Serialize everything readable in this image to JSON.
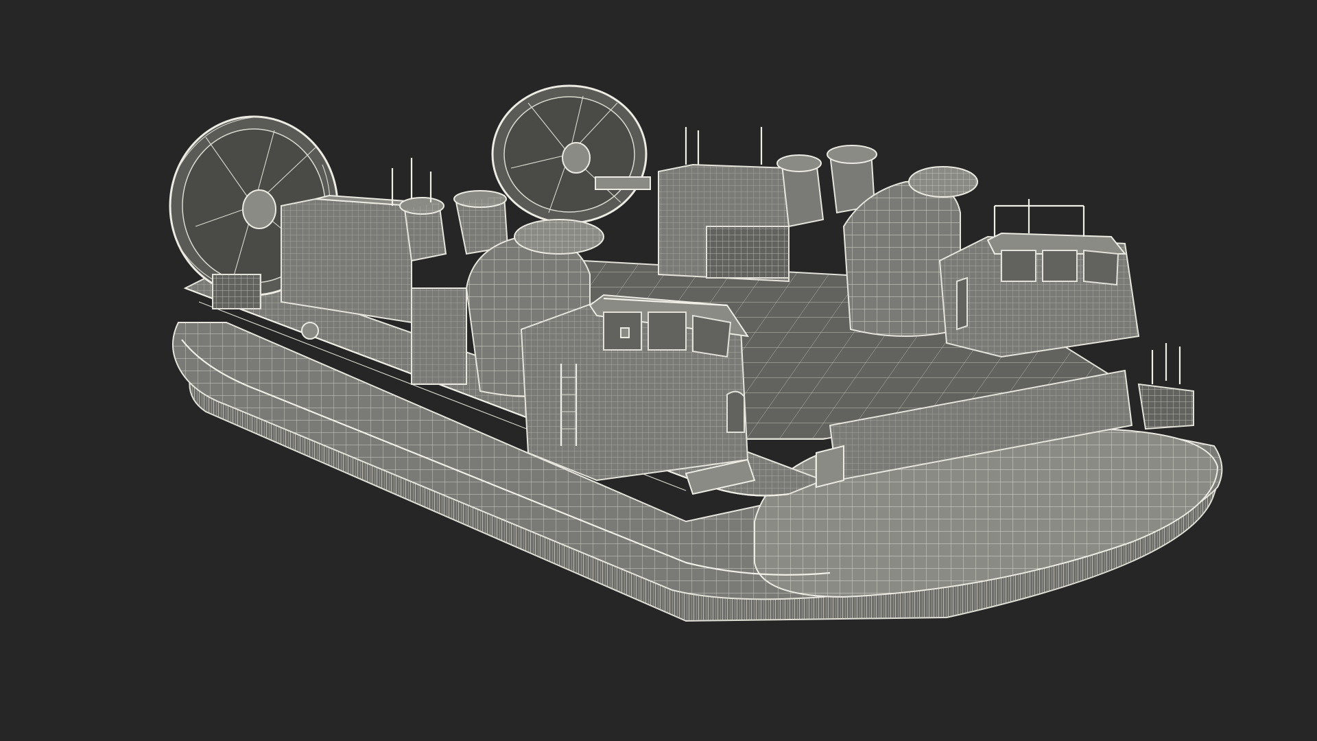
{
  "scene": {
    "background": "#262626",
    "mesh_fill": "#7a7b76",
    "wire_color": "#e6e6de"
  },
  "model": {
    "subject": "hovercraft",
    "render_style": "wireframe-on-shaded"
  }
}
